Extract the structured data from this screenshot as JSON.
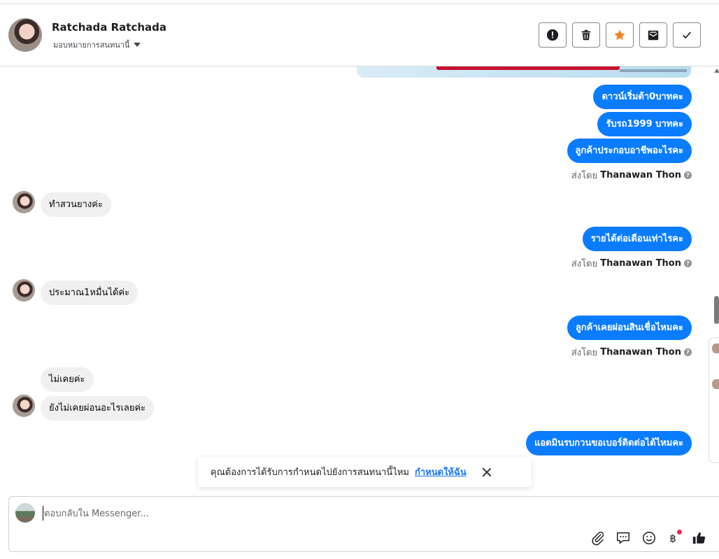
{
  "header": {
    "contact_name": "Ratchada Ratchada",
    "assign_label": "มอบหมายการสนทนานี้"
  },
  "messages": [
    {
      "type": "out",
      "text": "ดาวน์เริ่มต้า0บาทคะ"
    },
    {
      "type": "out",
      "text": "รับรถ1999 บาทคะ"
    },
    {
      "type": "out",
      "text": "ลูกค้าประกอบอาชีพอะไรคะ"
    },
    {
      "type": "sentby",
      "prefix": "ส่งโดย",
      "name": "Thanawan Thon"
    },
    {
      "type": "in",
      "text": "ทำสวนยางค่ะ"
    },
    {
      "type": "out",
      "text": "รายได้ต่อเดือนเท่าไรคะ"
    },
    {
      "type": "sentby",
      "prefix": "ส่งโดย",
      "name": "Thanawan Thon"
    },
    {
      "type": "in",
      "text": "ประมาณ1หมื่นได้ค่ะ"
    },
    {
      "type": "out",
      "text": "ลูกค้าเคยผ่อนสินเชื่อไหมคะ"
    },
    {
      "type": "sentby",
      "prefix": "ส่งโดย",
      "name": "Thanawan Thon"
    },
    {
      "type": "in",
      "text": "ไม่เคยค่ะ"
    },
    {
      "type": "in",
      "text": "ยังไม่เคยผ่อนอะไรเลยค่ะ"
    },
    {
      "type": "out",
      "text": "แอดมินรบกวนขอเบอร์ติดต่อได้ไหมคะ"
    }
  ],
  "toast": {
    "text": "คุณต้องการได้รับการกำหนดไปยังการสนทนานี้ไหม",
    "link": "กำหนดให้ฉัน"
  },
  "composer": {
    "placeholder": "ตอบกลับใน Messenger..."
  },
  "icons": {
    "header_actions": [
      "alert-icon",
      "trash-icon",
      "star-icon",
      "mark-unread-icon",
      "check-icon"
    ],
    "composer_tools": [
      "attach-icon",
      "saved-replies-icon",
      "emoji-icon",
      "baht-icon",
      "thumbs-up-icon"
    ]
  },
  "colors": {
    "outgoing_bubble": "#0a7cff",
    "incoming_bubble": "#f0f0f0",
    "star": "#f5821f",
    "link": "#1877f2"
  }
}
